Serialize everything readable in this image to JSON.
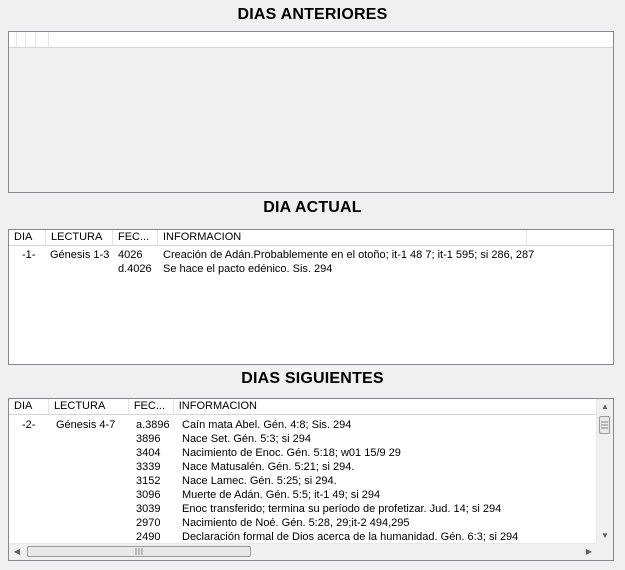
{
  "previous": {
    "title": "DIAS ANTERIORES"
  },
  "current": {
    "title": "DIA ACTUAL",
    "columns": [
      "DIA",
      "LECTURA",
      "FEC...",
      "INFORMACION"
    ],
    "rows": [
      {
        "dia": "-1-",
        "lectura": "Génesis 1-3",
        "fecha": "4026",
        "info": "Creación de Adán.Probablemente en el otoño; it-1 48 7; it-1 595; si 286, 287"
      },
      {
        "dia": "",
        "lectura": "",
        "fecha": "d.4026",
        "info": "Se hace el pacto edénico. Sis. 294"
      }
    ]
  },
  "next": {
    "title": "DIAS SIGUIENTES",
    "columns": [
      "DIA",
      "LECTURA",
      "FEC...",
      "INFORMACION"
    ],
    "rows": [
      {
        "dia": "-2-",
        "lectura": "Génesis 4-7",
        "fecha": "a.3896",
        "info": "Caín mata Abel. Gén. 4:8; Sis. 294"
      },
      {
        "dia": "",
        "lectura": "",
        "fecha": "3896",
        "info": "Nace Set. Gén. 5:3; si 294"
      },
      {
        "dia": "",
        "lectura": "",
        "fecha": "3404",
        "info": "Nacimiento de Enoc. Gén. 5:18; w01 15/9 29"
      },
      {
        "dia": "",
        "lectura": "",
        "fecha": "3339",
        "info": "Nace Matusalén. Gén. 5:21; si 294."
      },
      {
        "dia": "",
        "lectura": "",
        "fecha": "3152",
        "info": "Nace Lamec. Gén. 5:25; si 294."
      },
      {
        "dia": "",
        "lectura": "",
        "fecha": "3096",
        "info": "Muerte de Adán. Gén. 5:5; it-1 49; si 294"
      },
      {
        "dia": "",
        "lectura": "",
        "fecha": "3039",
        "info": "Enoc transferido; termina su período de profetizar. Jud. 14; si 294"
      },
      {
        "dia": "",
        "lectura": "",
        "fecha": "2970",
        "info": "Nacimiento de Noé. Gén. 5:28, 29;it-2 494,295"
      },
      {
        "dia": "",
        "lectura": "",
        "fecha": "2490",
        "info": "Declaración formal de Dios acerca de la humanidad. Gén. 6:3; si 294"
      }
    ]
  },
  "icons": {
    "scroll_up": "scroll-up-arrow-icon",
    "scroll_down": "scroll-down-arrow-icon",
    "scroll_left": "scroll-left-arrow-icon",
    "scroll_right": "scroll-right-arrow-icon"
  }
}
